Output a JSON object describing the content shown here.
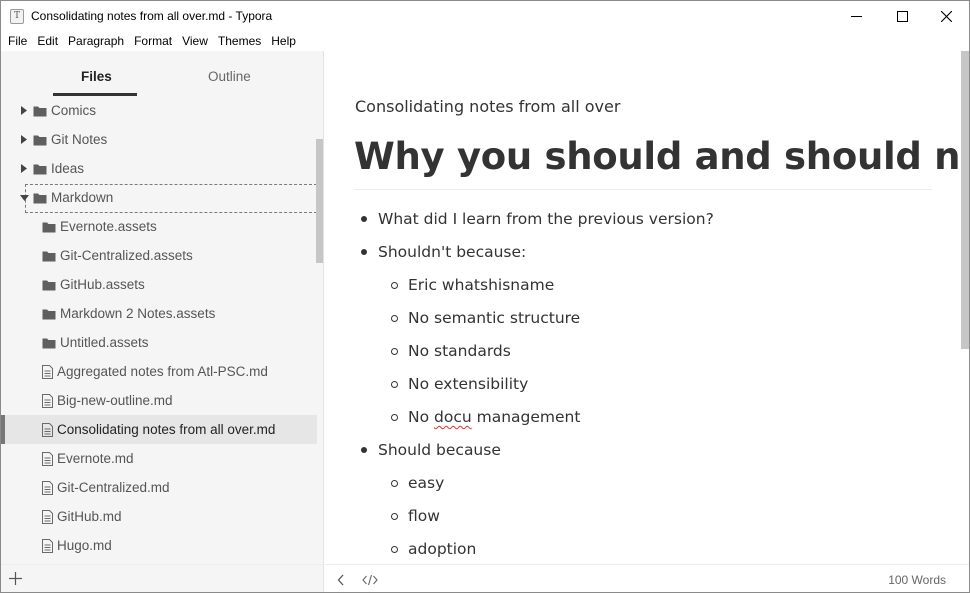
{
  "window": {
    "title": "Consolidating notes from all over.md - Typora",
    "app_icon_letter": "T"
  },
  "menu": [
    "File",
    "Edit",
    "Paragraph",
    "Format",
    "View",
    "Themes",
    "Help"
  ],
  "sidebar": {
    "tabs": {
      "files": "Files",
      "outline": "Outline",
      "active": "Files"
    },
    "tree": [
      {
        "label": "Comics",
        "type": "folder",
        "expanded": false,
        "level": 0
      },
      {
        "label": "Git Notes",
        "type": "folder",
        "expanded": false,
        "level": 0
      },
      {
        "label": "Ideas",
        "type": "folder",
        "expanded": false,
        "level": 0
      },
      {
        "label": "Markdown",
        "type": "folder",
        "expanded": true,
        "level": 0,
        "focused": true
      },
      {
        "label": "Evernote.assets",
        "type": "folder",
        "level": 1
      },
      {
        "label": "Git-Centralized.assets",
        "type": "folder",
        "level": 1
      },
      {
        "label": "GitHub.assets",
        "type": "folder",
        "level": 1
      },
      {
        "label": "Markdown 2 Notes.assets",
        "type": "folder",
        "level": 1
      },
      {
        "label": "Untitled.assets",
        "type": "folder",
        "level": 1
      },
      {
        "label": "Aggregated notes from Atl-PSC.md",
        "type": "file",
        "level": 1
      },
      {
        "label": "Big-new-outline.md",
        "type": "file",
        "level": 1
      },
      {
        "label": "Consolidating notes from all over.md",
        "type": "file",
        "level": 1,
        "active": true
      },
      {
        "label": "Evernote.md",
        "type": "file",
        "level": 1
      },
      {
        "label": "Git-Centralized.md",
        "type": "file",
        "level": 1
      },
      {
        "label": "GitHub.md",
        "type": "file",
        "level": 1
      },
      {
        "label": "Hugo.md",
        "type": "file",
        "level": 1
      }
    ]
  },
  "document": {
    "subtitle": "Consolidating notes from all over",
    "heading": "Why you should and should not",
    "list": [
      {
        "text": "What did I learn from the previous version?",
        "level": 0
      },
      {
        "text": "Shouldn't because:",
        "level": 0
      },
      {
        "text": "Eric whatshisname",
        "level": 1
      },
      {
        "text": "No semantic structure",
        "level": 1
      },
      {
        "text": "No standards",
        "level": 1
      },
      {
        "text": "No extensibility",
        "level": 1
      },
      {
        "text_before": "No ",
        "text_misspelled": "docu",
        "text_after": " management",
        "level": 1
      },
      {
        "text": "Should because",
        "level": 0
      },
      {
        "text": "easy",
        "level": 1
      },
      {
        "text": "flow",
        "level": 1
      },
      {
        "text": "adoption",
        "level": 1
      }
    ]
  },
  "status": {
    "word_count": "100 Words"
  },
  "icons": {
    "minimize": "minimize-icon",
    "maximize": "maximize-icon",
    "close": "close-icon",
    "folder": "folder-icon",
    "file": "file-icon",
    "caret_right": "caret-right-icon",
    "caret_down": "caret-down-icon",
    "add": "plus-icon",
    "back": "chevron-left-icon",
    "source": "code-icon"
  }
}
